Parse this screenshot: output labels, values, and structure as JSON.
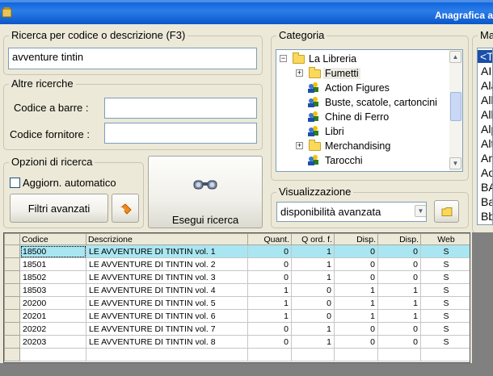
{
  "window": {
    "title": "Anagrafica a"
  },
  "search": {
    "label": "Ricerca per codice o descrizione (F3)",
    "value": "avventure tintin"
  },
  "altre": {
    "label": "Altre ricerche",
    "barcode_label": "Codice a barre :",
    "barcode_value": "",
    "supplier_label": "Codice fornitore :",
    "supplier_value": ""
  },
  "opzioni": {
    "label": "Opzioni di ricerca",
    "auto_update_label": "Aggiorn. automatico",
    "auto_update_checked": false,
    "advanced_filters_label": "Filtri avanzati"
  },
  "execute": {
    "label": "Esegui ricerca",
    "icon": "binoculars-icon"
  },
  "categoria": {
    "label": "Categoria",
    "items": [
      {
        "label": "La Libreria",
        "icon": "folder-icon",
        "expander": "−"
      },
      {
        "label": "Fumetti",
        "icon": "folder-icon",
        "expander": "+"
      },
      {
        "label": "Action Figures",
        "icon": "users-icon",
        "expander": ""
      },
      {
        "label": "Buste, scatole, cartoncini",
        "icon": "users-icon",
        "expander": ""
      },
      {
        "label": "Chine di Ferro",
        "icon": "users-icon",
        "expander": ""
      },
      {
        "label": "Libri",
        "icon": "users-icon",
        "expander": ""
      },
      {
        "label": "Merchandising",
        "icon": "folder-icon",
        "expander": "+"
      },
      {
        "label": "Tarocchi",
        "icon": "users-icon",
        "expander": ""
      }
    ]
  },
  "visualizzazione": {
    "label": "Visualizzazione",
    "selected": "disponibilità avanzata"
  },
  "marca": {
    "label": "Ma",
    "items": [
      "<T",
      "AII",
      "Ala",
      "Alb",
      "Alb",
      "Alp",
      "Alt",
      "An",
      "Ao",
      "BA",
      "Ba",
      "Bb"
    ]
  },
  "grid": {
    "columns": [
      "Codice",
      "Descrizione",
      "Quant.",
      "Q ord. f.",
      "Disp.",
      "Disp.",
      "Web"
    ],
    "rows": [
      [
        "18500",
        "LE AVVENTURE DI TINTIN vol. 1",
        "0",
        "1",
        "0",
        "0",
        "S"
      ],
      [
        "18501",
        "LE AVVENTURE DI TINTIN vol. 2",
        "0",
        "1",
        "0",
        "0",
        "S"
      ],
      [
        "18502",
        "LE AVVENTURE DI TINTIN vol. 3",
        "0",
        "1",
        "0",
        "0",
        "S"
      ],
      [
        "18503",
        "LE AVVENTURE DI TINTIN vol. 4",
        "1",
        "0",
        "1",
        "1",
        "S"
      ],
      [
        "20200",
        "LE AVVENTURE DI TINTIN vol. 5",
        "1",
        "0",
        "1",
        "1",
        "S"
      ],
      [
        "20201",
        "LE AVVENTURE DI TINTIN vol. 6",
        "1",
        "0",
        "1",
        "1",
        "S"
      ],
      [
        "20202",
        "LE AVVENTURE DI TINTIN vol. 7",
        "0",
        "1",
        "0",
        "0",
        "S"
      ],
      [
        "20203",
        "LE AVVENTURE DI TINTIN vol. 8",
        "0",
        "1",
        "0",
        "0",
        "S"
      ]
    ]
  }
}
